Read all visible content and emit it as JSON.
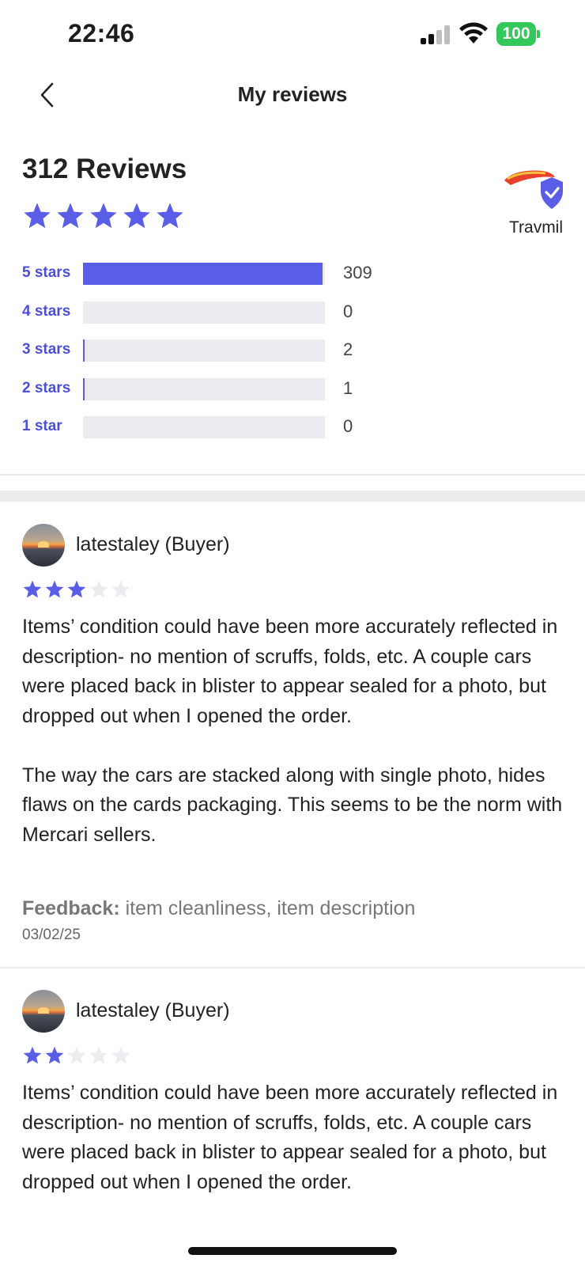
{
  "status_bar": {
    "time": "22:46",
    "battery": "100"
  },
  "nav": {
    "title": "My reviews"
  },
  "summary": {
    "total_label": "312 Reviews",
    "rating": 5,
    "seller_name": "Travmil",
    "distribution": [
      {
        "label": "5 stars",
        "count": "309",
        "fraction": 0.99
      },
      {
        "label": "4 stars",
        "count": "0",
        "fraction": 0.0
      },
      {
        "label": "3 stars",
        "count": "2",
        "fraction": 0.006
      },
      {
        "label": "2 stars",
        "count": "1",
        "fraction": 0.003
      },
      {
        "label": "1 star",
        "count": "0",
        "fraction": 0.0
      }
    ]
  },
  "colors": {
    "accent": "#5a5ee6",
    "star_empty": "#ececf0",
    "battery": "#34c759"
  },
  "reviews": [
    {
      "reviewer": "latestaley (Buyer)",
      "rating": 3,
      "paragraphs": [
        "Items’ condition could have been more accurately reflected in description- no mention of scruffs, folds, etc. A couple cars were placed back in blister to appear sealed for a photo, but dropped out when I opened the order.",
        "The way the cars are stacked along with single photo, hides flaws on the cards packaging. This seems to be the norm with Mercari sellers."
      ],
      "feedback_label": "Feedback:",
      "feedback_value": " item cleanliness, item description",
      "date": "03/02/25"
    },
    {
      "reviewer": "latestaley (Buyer)",
      "rating": 2,
      "paragraphs": [
        "Items’ condition could have been more accurately reflected in description- no mention of scruffs, folds, etc. A couple cars were placed back in blister to appear sealed for a photo, but dropped out when I opened the order."
      ]
    }
  ]
}
